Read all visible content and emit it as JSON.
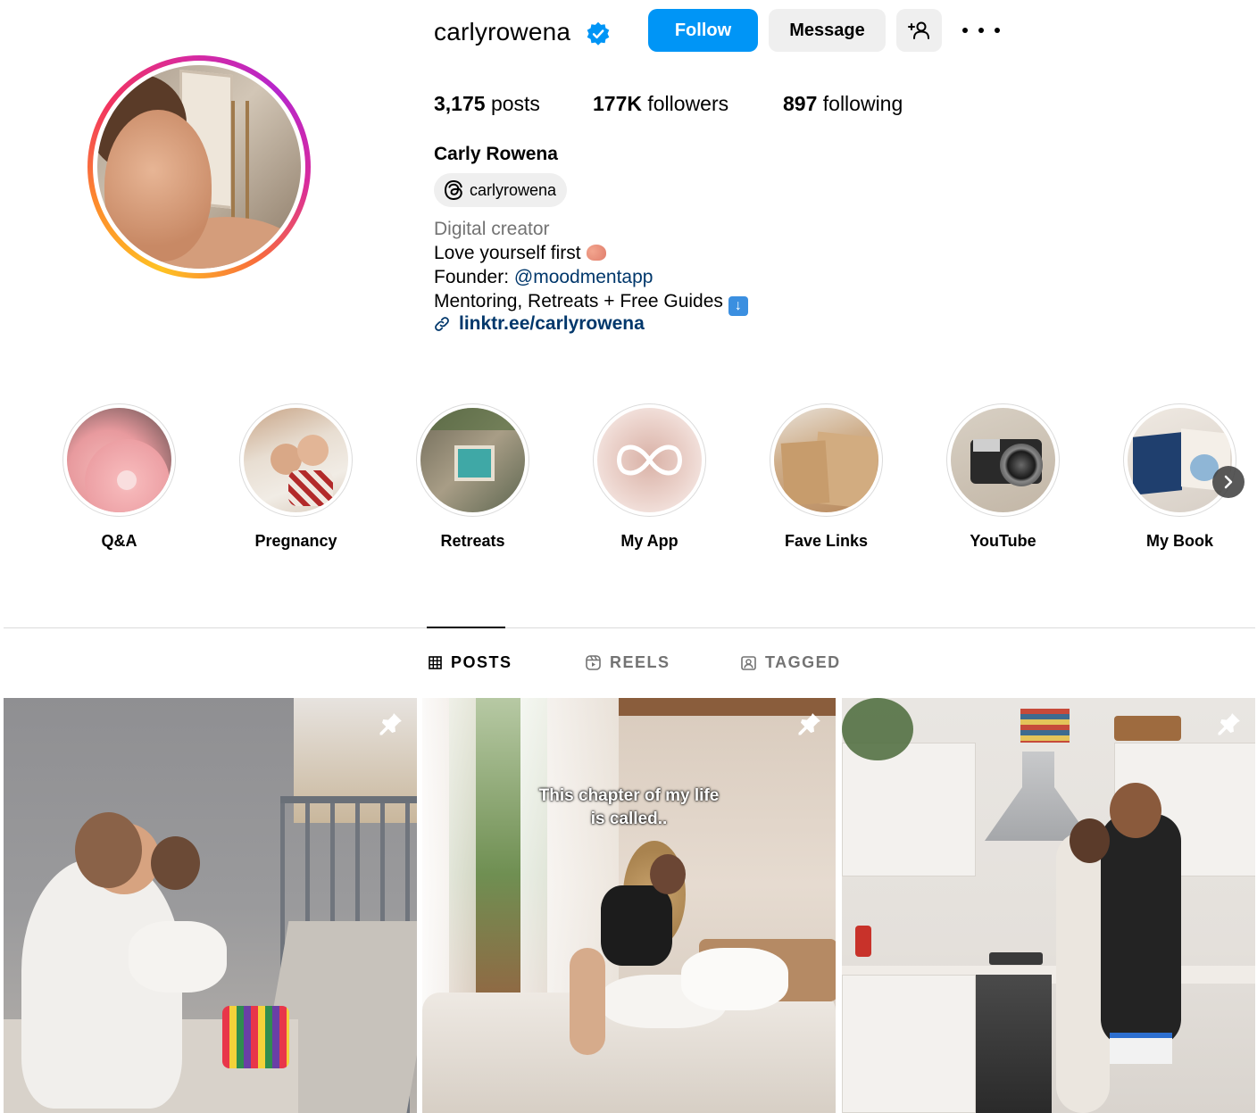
{
  "profile": {
    "username": "carlyrowena",
    "verified": true,
    "follow_label": "Follow",
    "message_label": "Message",
    "full_name": "Carly Rowena",
    "threads_handle": "carlyrowena",
    "category": "Digital creator",
    "bio_line1": "Love yourself first",
    "bio_line2_prefix": "Founder: ",
    "bio_mention": "@moodmentapp",
    "bio_line3": "Mentoring, Retreats + Free Guides",
    "link": "linktr.ee/carlyrowena"
  },
  "stats": {
    "posts_count": "3,175",
    "posts_label": " posts",
    "followers_count": "177K",
    "followers_label": " followers",
    "following_count": "897",
    "following_label": " following"
  },
  "highlights": [
    {
      "label": "Q&A"
    },
    {
      "label": "Pregnancy"
    },
    {
      "label": "Retreats"
    },
    {
      "label": "My App"
    },
    {
      "label": "Fave Links"
    },
    {
      "label": "YouTube"
    },
    {
      "label": "My Book"
    }
  ],
  "tabs": {
    "posts": "POSTS",
    "reels": "REELS",
    "tagged": "TAGGED"
  },
  "posts": [
    {
      "pinned": true,
      "caption": ""
    },
    {
      "pinned": true,
      "caption_line1": "This chapter of my life",
      "caption_line2": "is called.."
    },
    {
      "pinned": true,
      "caption": ""
    }
  ],
  "colors": {
    "accent": "#0095f6",
    "link": "#00376b",
    "muted": "#737373",
    "button_bg": "#efefef"
  },
  "icons": [
    "verified-badge-icon",
    "add-user-icon",
    "more-options-icon",
    "threads-icon",
    "link-icon",
    "grid-icon",
    "reels-icon",
    "tagged-icon",
    "pin-icon",
    "chevron-right-icon"
  ]
}
